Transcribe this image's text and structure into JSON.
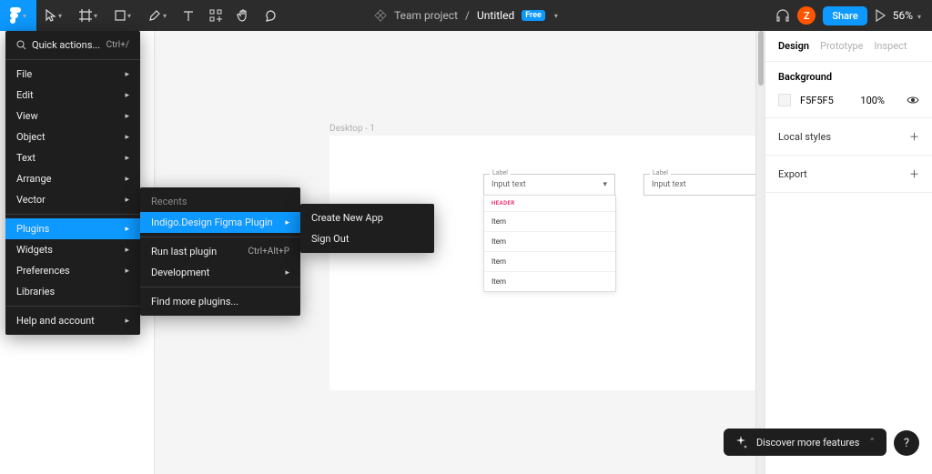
{
  "toolbar": {
    "team": "Team project",
    "separator": "/",
    "file": "Untitled",
    "badge": "Free",
    "avatar_letter": "Z",
    "share": "Share",
    "zoom": "56%"
  },
  "main_menu": {
    "quick_actions": "Quick actions...",
    "quick_shortcut": "Ctrl+/",
    "items": [
      "File",
      "Edit",
      "View",
      "Object",
      "Text",
      "Arrange",
      "Vector"
    ],
    "plugins": "Plugins",
    "widgets": "Widgets",
    "preferences": "Preferences",
    "libraries": "Libraries",
    "help": "Help and account"
  },
  "plugins_menu": {
    "recents": "Recents",
    "indigo": "Indigo.Design Figma Plugin",
    "run_last": "Run last plugin",
    "run_last_shortcut": "Ctrl+Alt+P",
    "development": "Development",
    "find_more": "Find more plugins..."
  },
  "indigo_menu": {
    "create": "Create New App",
    "signout": "Sign Out"
  },
  "canvas": {
    "frame_label": "Desktop - 1",
    "input_label": "Label",
    "input_value": "Input text",
    "list_header": "HEADER",
    "list_item": "Item"
  },
  "right": {
    "tabs": [
      "Design",
      "Prototype",
      "Inspect"
    ],
    "background": "Background",
    "bg_hex": "F5F5F5",
    "bg_opacity": "100%",
    "local_styles": "Local styles",
    "export": "Export"
  },
  "footer": {
    "discover": "Discover more features",
    "help": "?"
  }
}
